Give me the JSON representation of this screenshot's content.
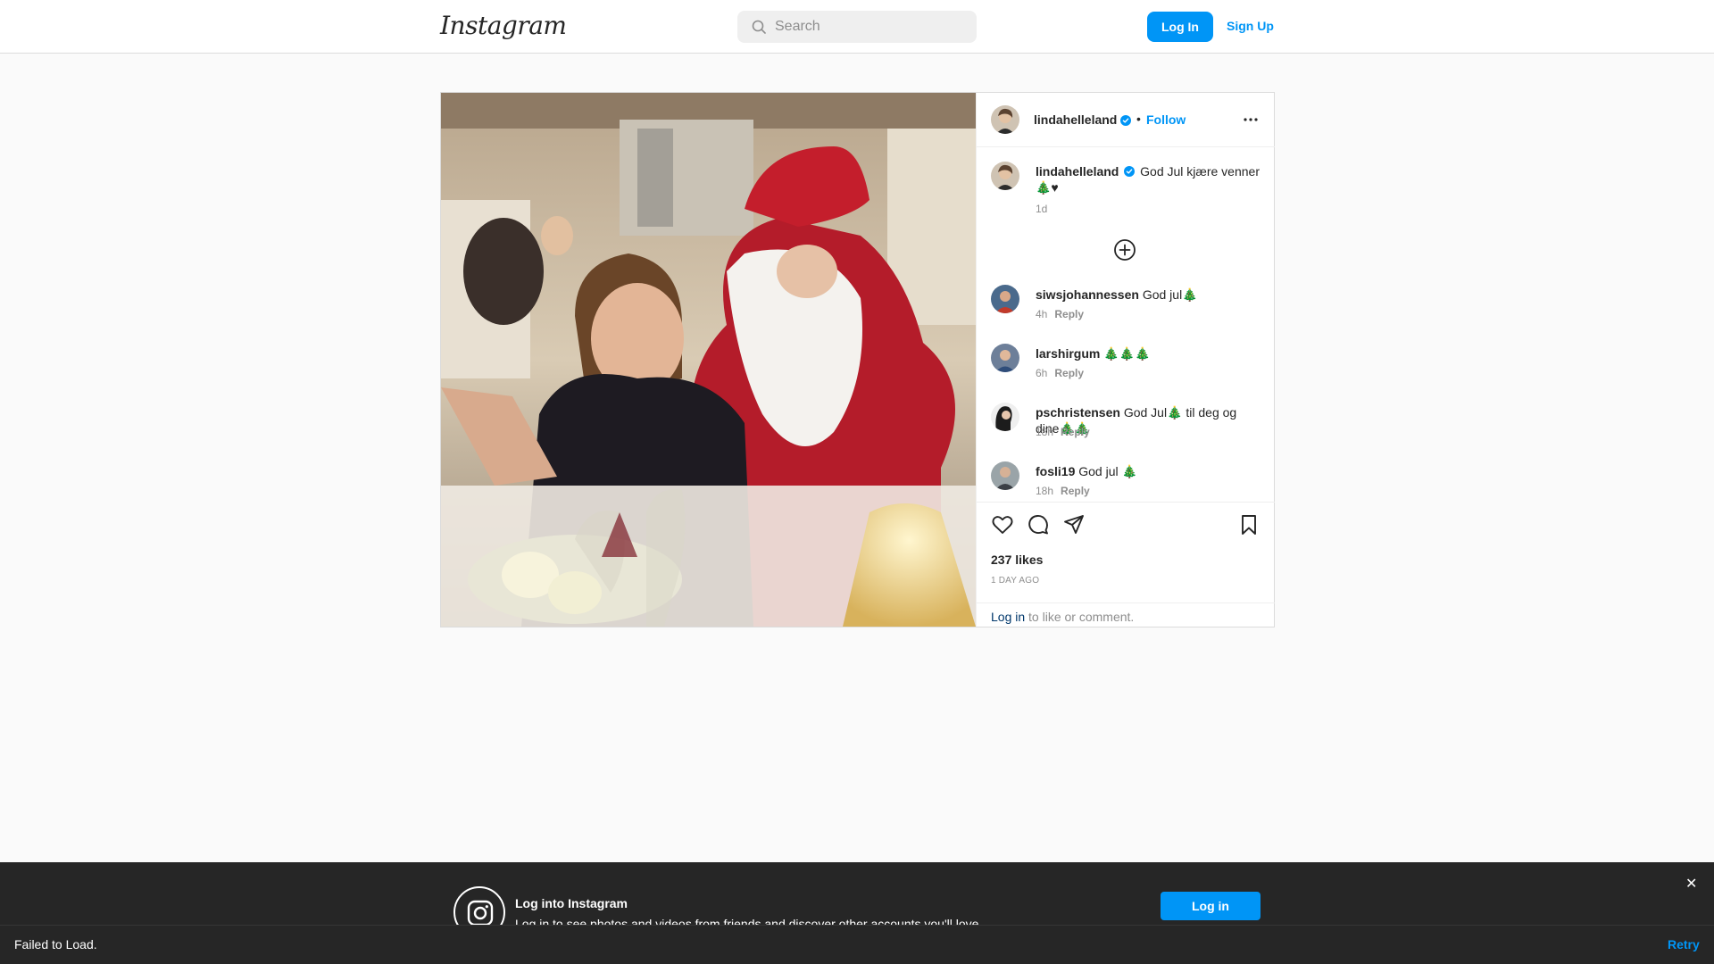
{
  "header": {
    "logo_text": "Instagram",
    "search_placeholder": "Search",
    "login_label": "Log In",
    "signup_label": "Sign Up"
  },
  "post": {
    "author": "lindahelleland",
    "follow_label": "Follow",
    "separator": "•",
    "caption": {
      "user": "lindahelleland",
      "text": "God Jul kjære venner 🎄♥",
      "time": "1d"
    },
    "comments": [
      {
        "user": "siwsjohannessen",
        "text": "God jul🎄",
        "time": "4h",
        "reply_label": "Reply"
      },
      {
        "user": "larshirgum",
        "text": "🎄🎄🎄",
        "time": "6h",
        "reply_label": "Reply"
      },
      {
        "user": "pschristensen",
        "text": "God Jul🎄 til deg og dine🎄🎄",
        "time": "18h",
        "reply_label": "Reply"
      },
      {
        "user": "fosli19",
        "text": "God jul 🎄",
        "time": "18h",
        "reply_label": "Reply"
      }
    ],
    "likes": "237 likes",
    "posted_ago": "1 DAY AGO",
    "login_link": "Log in",
    "login_suffix": " to like or comment."
  },
  "banner": {
    "title": "Log into Instagram",
    "subtitle": "Log in to see photos and videos from friends and discover other accounts you'll love.",
    "button_label": "Log in",
    "close_glyph": "✕"
  },
  "toast": {
    "message": "Failed to Load.",
    "action": "Retry"
  },
  "colors": {
    "accent": "#0095f6",
    "verified": "#0095f6",
    "banner_bg": "#262626"
  },
  "icons": [
    "search-icon",
    "verified-icon",
    "more-icon",
    "add-circle-icon",
    "heart-icon",
    "comment-icon",
    "share-icon",
    "bookmark-icon",
    "instagram-icon",
    "close-icon"
  ]
}
